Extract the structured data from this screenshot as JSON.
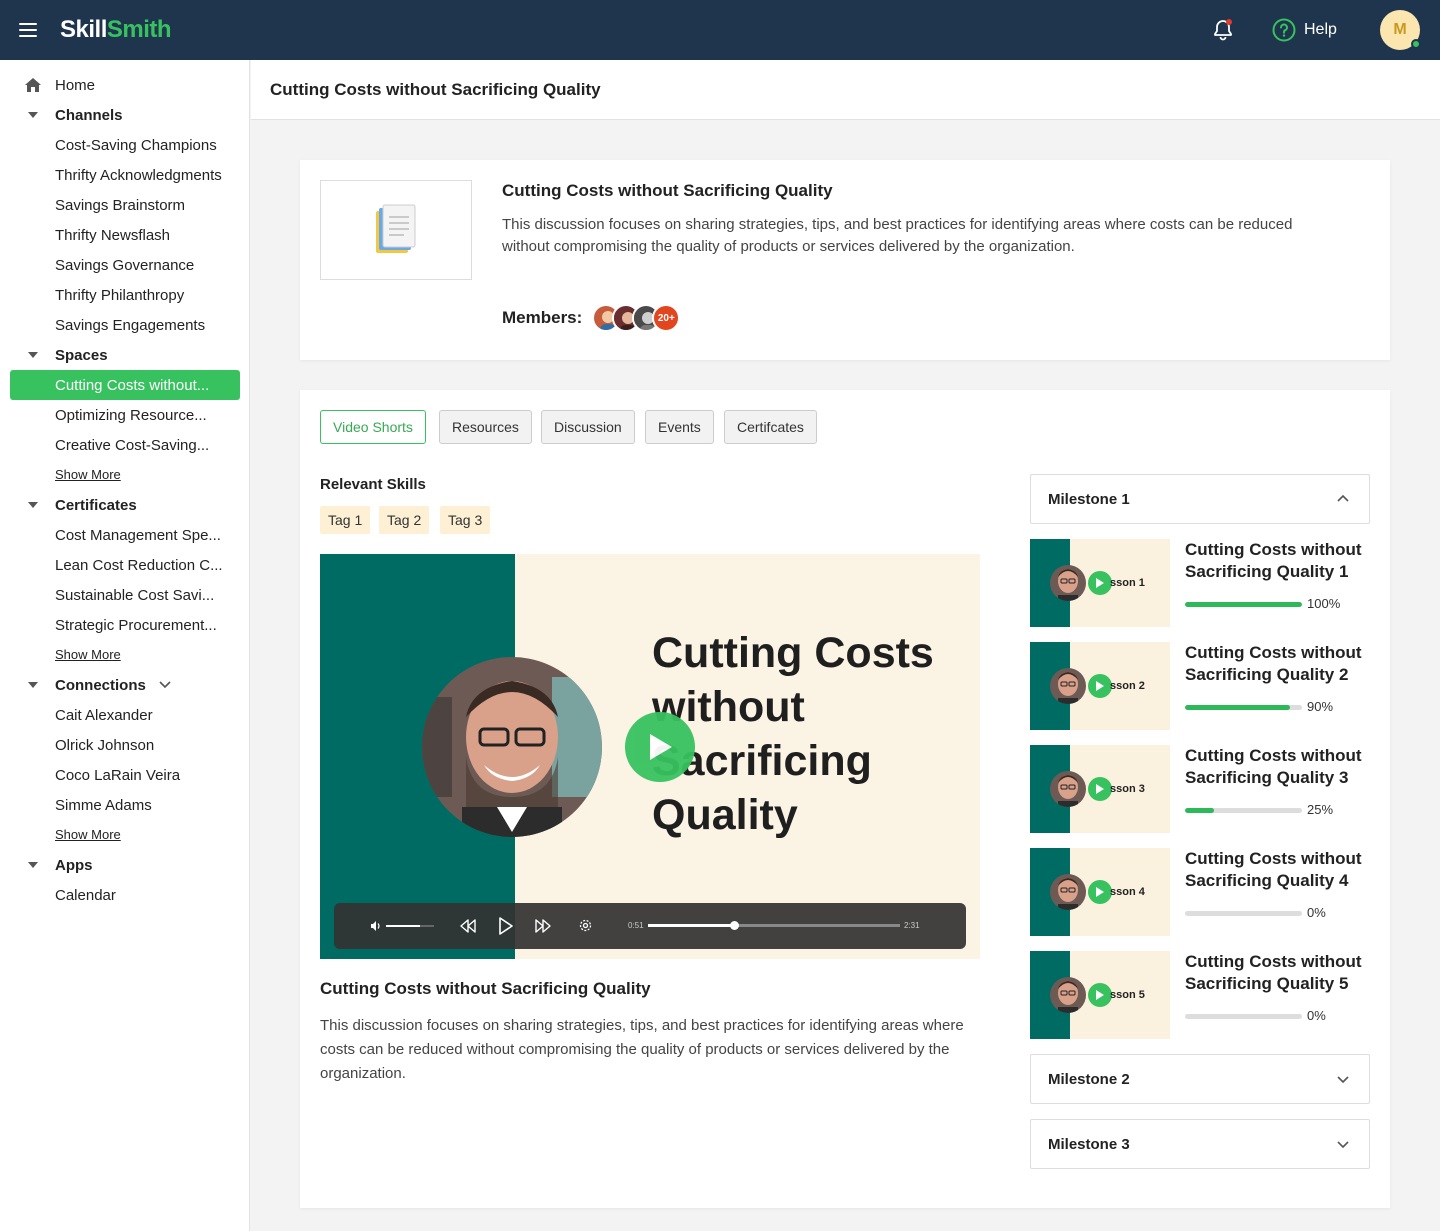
{
  "topbar": {
    "logo_part1": "Skill",
    "logo_part2": "Smith",
    "help_label": "Help",
    "avatar_initial": "M",
    "colors": {
      "bar": "#1e354d",
      "accent": "#37c25f"
    }
  },
  "sidebar": {
    "home": "Home",
    "channels_label": "Channels",
    "channels": [
      "Cost-Saving Champions",
      "Thrifty Acknowledgments",
      "Savings Brainstorm",
      "Thrifty Newsflash",
      "Savings Governance",
      "Thrifty Philanthropy",
      "Savings Engagements"
    ],
    "spaces_label": "Spaces",
    "spaces": [
      "Cutting Costs without...",
      "Optimizing Resource...",
      "Creative Cost-Saving..."
    ],
    "show_more": "Show More",
    "certificates_label": "Certificates",
    "certificates": [
      "Cost Management Spe...",
      "Lean Cost Reduction C...",
      "Sustainable Cost Savi...",
      "Strategic Procurement..."
    ],
    "connections_label": "Connections",
    "connections": [
      "Cait Alexander",
      "Olrick Johnson",
      "Coco LaRain Veira",
      "Simme Adams"
    ],
    "apps_label": "Apps",
    "apps": [
      "Calendar"
    ]
  },
  "header": {
    "title": "Cutting Costs without Sacrificing Quality"
  },
  "info": {
    "title": "Cutting Costs without Sacrificing Quality",
    "description": "This discussion focuses on sharing strategies, tips, and best practices for identifying areas where costs can be reduced without compromising the quality of products or services delivered by the organization.",
    "members_label": "Members:",
    "members_more": "20+"
  },
  "tabs": [
    "Video Shorts",
    "Resources",
    "Discussion",
    "Events",
    "Certifcates"
  ],
  "skills": {
    "label": "Relevant Skills",
    "tags": [
      "Tag 1",
      "Tag 2",
      "Tag 3"
    ]
  },
  "video": {
    "overlay_title": "Cutting Costs without Sacrificing Quality",
    "current_time": "0:51",
    "total_time": "2:31",
    "progress": 0.34,
    "volume": 0.7,
    "title": "Cutting Costs without Sacrificing Quality",
    "description": "This discussion focuses on sharing strategies, tips, and best practices for identifying areas where costs can be reduced without compromising the quality of products or services delivered by the organization."
  },
  "milestones": [
    {
      "label": "Milestone 1",
      "expanded": true
    },
    {
      "label": "Milestone 2",
      "expanded": false
    },
    {
      "label": "Milestone 3",
      "expanded": false
    }
  ],
  "lessons": [
    {
      "thumb_label": "sson 1",
      "title": "Cutting Costs without Sacrificing Quality 1",
      "progress": 100,
      "progress_label": "100%"
    },
    {
      "thumb_label": "sson 2",
      "title": "Cutting Costs without Sacrificing Quality 2",
      "progress": 90,
      "progress_label": "90%"
    },
    {
      "thumb_label": "sson 3",
      "title": "Cutting Costs without Sacrificing Quality 3",
      "progress": 25,
      "progress_label": "25%"
    },
    {
      "thumb_label": "sson 4",
      "title": "Cutting Costs without Sacrificing Quality 4",
      "progress": 0,
      "progress_label": "0%"
    },
    {
      "thumb_label": "sson 5",
      "title": "Cutting Costs without Sacrificing Quality 5",
      "progress": 0,
      "progress_label": "0%"
    }
  ]
}
